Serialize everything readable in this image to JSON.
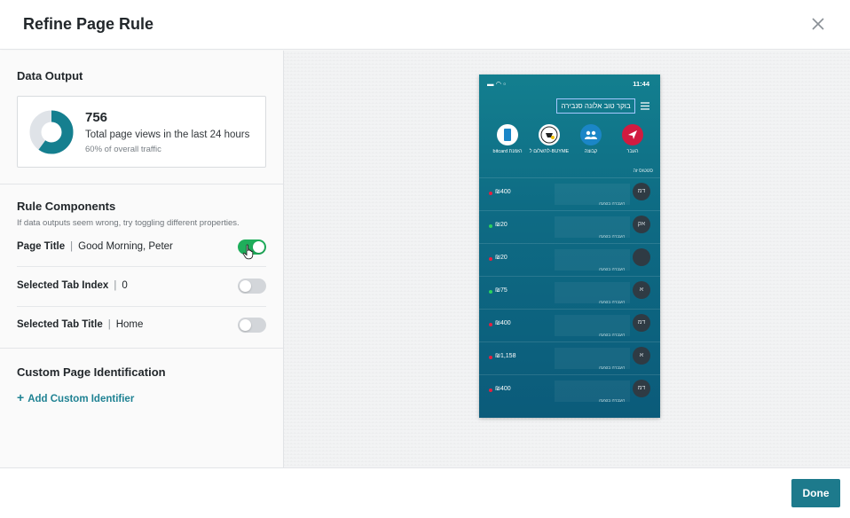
{
  "header": {
    "title": "Refine Page Rule",
    "close_icon": "close-icon"
  },
  "data_output": {
    "title": "Data Output",
    "count": "756",
    "description": "Total page views in the last 24 hours",
    "traffic": "60% of overall traffic",
    "traffic_fraction": 0.6,
    "colors": {
      "primary": "#157f8f",
      "secondary": "#dfe3e8"
    }
  },
  "rule_components": {
    "title": "Rule Components",
    "help": "If data outputs seem wrong, try toggling different properties.",
    "rows": [
      {
        "label": "Page Title",
        "value": "Good Morning, Peter",
        "enabled": true
      },
      {
        "label": "Selected Tab Index",
        "value": "0",
        "enabled": false
      },
      {
        "label": "Selected Tab Title",
        "value": "Home",
        "enabled": false
      }
    ]
  },
  "custom_page": {
    "title": "Custom Page Identification",
    "add_label": "Add Custom Identifier"
  },
  "preview": {
    "time": "11:44",
    "title": "בוקר טוב אלונה סנבירה",
    "tabs": [
      {
        "label": "העבר",
        "color": "#d11b40",
        "icon": "send-icon"
      },
      {
        "label": "קבוצה",
        "color": "#1b86c7",
        "icon": "group-icon"
      },
      {
        "label": "לתשלום ל-BUYME",
        "color": "#ffffff",
        "icon": "buyme-logo-icon"
      },
      {
        "label": "bitcard הזמנת",
        "color": "#1b86c7",
        "icon": "card-icon"
      }
    ],
    "list_header": "סטטוס זה",
    "items": [
      {
        "value": "₪400",
        "dot": "#e5203f",
        "avatar": "דמ",
        "note": "העברה בוצעה"
      },
      {
        "value": "₪20",
        "dot": "#2bd15b",
        "avatar": "אק",
        "note": "העברה בוצעה"
      },
      {
        "value": "₪20",
        "dot": "#e5203f",
        "avatar": "",
        "note": "העברה בוצעה"
      },
      {
        "value": "₪75",
        "dot": "#2bd15b",
        "avatar": "א",
        "note": "העברה בוצעה"
      },
      {
        "value": "₪400",
        "dot": "#e5203f",
        "avatar": "דמ",
        "note": "העברה בוצעה"
      },
      {
        "value": "₪1,158",
        "dot": "#e5203f",
        "avatar": "א",
        "note": "העברה בוצעה"
      },
      {
        "value": "₪400",
        "dot": "#e5203f",
        "avatar": "דמ",
        "note": "העברה בוצעה"
      }
    ]
  },
  "footer": {
    "done_label": "Done"
  }
}
